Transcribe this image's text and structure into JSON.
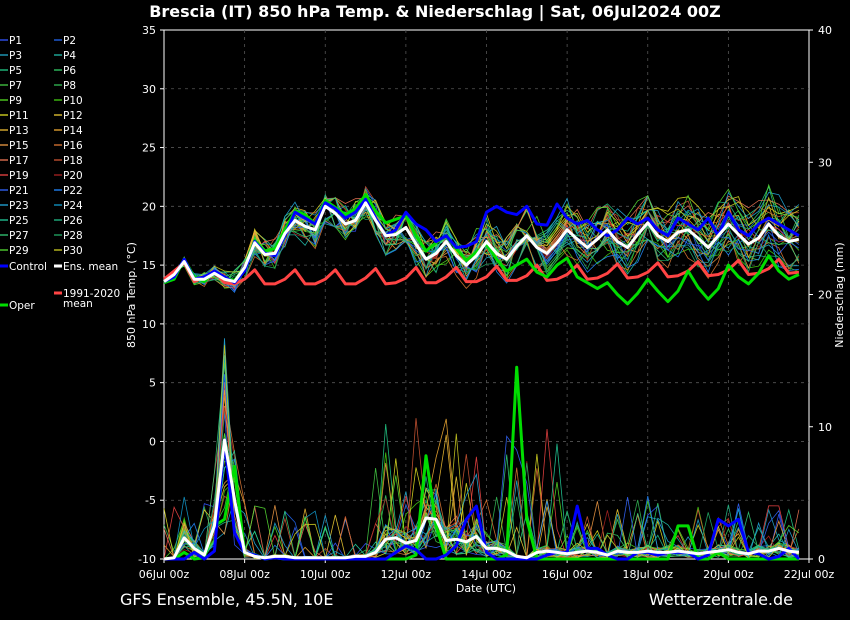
{
  "chart_data": {
    "type": "line",
    "title": "Brescia  (IT)  850 hPa Temp. & Niederschlag | Sat, 06Jul2024 00Z",
    "ylabel_left": "850 hPa Temp. (°C)",
    "ylabel_right": "Niederschlag (mm)",
    "xlabel": "Date (UTC)",
    "ylim_left": [
      -10,
      35
    ],
    "ylim_right": [
      0,
      40
    ],
    "left_ticks": [
      -10,
      -5,
      0,
      5,
      10,
      15,
      20,
      25,
      30,
      35
    ],
    "right_ticks": [
      0,
      10,
      20,
      30,
      40
    ],
    "x_ticks": [
      "06Jul 00z",
      "08Jul 00z",
      "10Jul 00z",
      "12Jul 00z",
      "14Jul 00z",
      "16Jul 00z",
      "18Jul 00z",
      "20Jul 00z",
      "22Jul 00z"
    ],
    "x_step_hours": 6,
    "grid": true,
    "legend_placement": "left outside",
    "series": [
      {
        "name": "Control",
        "color": "#0000ff",
        "temp": [
          13.6,
          14,
          15.5,
          13.8,
          14,
          14.5,
          14,
          13.5,
          14.5,
          17,
          16,
          15.8,
          17.5,
          19.5,
          19,
          18.5,
          20.3,
          19.8,
          19,
          19.5,
          20.6,
          19,
          17.5,
          18,
          19.5,
          18.5,
          18,
          17,
          17.5,
          16.5,
          16.6,
          17,
          19.5,
          20,
          19.5,
          19.3,
          20,
          18.5,
          18.4,
          20.2,
          19,
          18.5,
          18.8,
          18,
          17.5,
          18,
          19,
          18.5,
          19,
          18,
          17.5,
          19,
          18.5,
          18,
          19,
          17.5,
          19.5,
          18,
          17.5,
          18.5,
          19,
          18.5,
          18,
          17.5
        ],
        "precip": [
          0,
          0,
          0,
          0.5,
          0,
          0.6,
          9,
          2,
          0.5,
          0.3,
          0,
          0.1,
          0,
          0,
          0,
          0,
          0,
          0,
          0,
          0,
          0,
          0,
          0,
          0.5,
          1,
          0.7,
          0,
          0,
          0.3,
          1,
          3,
          4,
          0.5,
          0,
          0,
          0,
          0,
          0,
          0.3,
          0.5,
          0.5,
          4,
          0.8,
          0.8,
          0.3,
          0,
          0,
          0.5,
          0.5,
          0.3,
          0.5,
          0.5,
          0.5,
          0,
          0.3,
          3,
          2.5,
          3,
          0.5,
          0.4,
          0,
          0.2,
          0.8,
          0
        ]
      },
      {
        "name": "Ens. mean",
        "color": "#ffffff",
        "temp": [
          13.6,
          14.2,
          15.3,
          13.8,
          13.8,
          14.3,
          13.8,
          13.6,
          14.8,
          16.9,
          15.9,
          16,
          17.7,
          18.8,
          18.3,
          18,
          20,
          19.4,
          18.5,
          18.8,
          20.3,
          18.8,
          17.5,
          17.6,
          18.2,
          16.8,
          15.5,
          16,
          17,
          15.8,
          15,
          15.8,
          17,
          16,
          15.5,
          16.6,
          17.5,
          16.5,
          16,
          16.9,
          18,
          17.2,
          16.5,
          17.2,
          18,
          17,
          16.5,
          17.6,
          18.6,
          17.5,
          17,
          17.8,
          18,
          17.3,
          16.5,
          17.5,
          18.5,
          17.6,
          16.8,
          17.3,
          18.5,
          17.5,
          17,
          17.2
        ],
        "precip": [
          0,
          0.1,
          1.6,
          0.8,
          0.3,
          2.5,
          9,
          4.5,
          0.5,
          0.2,
          0.1,
          0.2,
          0.2,
          0.1,
          0.1,
          0.1,
          0.1,
          0.1,
          0.1,
          0.2,
          0.2,
          0.5,
          1.5,
          1.6,
          1.2,
          1.4,
          3.1,
          3,
          1.4,
          1.5,
          1.3,
          1.7,
          0.8,
          0.8,
          0.6,
          0.2,
          0.1,
          0.5,
          0.6,
          0.5,
          0.4,
          0.5,
          0.6,
          0.5,
          0.3,
          0.6,
          0.5,
          0.5,
          0.6,
          0.5,
          0.5,
          0.6,
          0.5,
          0.4,
          0.5,
          0.6,
          0.7,
          0.5,
          0.4,
          0.6,
          0.6,
          0.8,
          0.6,
          0.5
        ]
      },
      {
        "name": "Oper",
        "color": "#00dd00",
        "temp": [
          13.5,
          13.8,
          15.5,
          14,
          13.6,
          14.5,
          13.9,
          13.7,
          14.8,
          17.1,
          16.2,
          16.4,
          18,
          19.6,
          19.3,
          18.5,
          20.5,
          19.9,
          19.3,
          19.8,
          21,
          19.6,
          18.6,
          18.9,
          19.2,
          17.5,
          16.2,
          16.9,
          17.5,
          16.4,
          15.4,
          16.1,
          16.8,
          15.5,
          14.5,
          15,
          15.5,
          14.4,
          14,
          15,
          15.6,
          14,
          13.5,
          13,
          13.5,
          12.5,
          11.7,
          12.6,
          13.8,
          12.8,
          11.9,
          12.8,
          14.5,
          13.1,
          12.1,
          13,
          15,
          14,
          13.4,
          14.3,
          15.8,
          14.5,
          13.8,
          14.2
        ],
        "precip": [
          0,
          0,
          0.5,
          0,
          0.1,
          2.5,
          3,
          7,
          0.5,
          0.3,
          0,
          0.1,
          0,
          0,
          0,
          0,
          0,
          0,
          0,
          0,
          0,
          0,
          0,
          0,
          0,
          0.3,
          7.8,
          2.5,
          0,
          0,
          0,
          0,
          0,
          0,
          0.3,
          14.5,
          3,
          0,
          0,
          0,
          0,
          0,
          0,
          0,
          0,
          0,
          0,
          0,
          0,
          0,
          0,
          2.5,
          2.5,
          0,
          0,
          0.5,
          0,
          0,
          0,
          0,
          0,
          0,
          0,
          0
        ]
      },
      {
        "name": "1991-2020 mean",
        "color": "#ff4444",
        "temp": [
          13.8,
          14.5,
          15.2,
          13.6,
          14,
          14.5,
          13.5,
          13.4,
          13.8,
          14.6,
          13.4,
          13.4,
          13.8,
          14.6,
          13.4,
          13.4,
          13.8,
          14.6,
          13.4,
          13.4,
          13.9,
          14.7,
          13.4,
          13.5,
          13.9,
          14.8,
          13.5,
          13.5,
          14,
          14.8,
          13.6,
          13.6,
          14,
          14.9,
          13.7,
          13.7,
          14.1,
          15,
          13.7,
          13.8,
          14.2,
          15,
          13.8,
          13.9,
          14.3,
          15.1,
          13.9,
          14,
          14.4,
          15.2,
          14,
          14.1,
          14.5,
          15.3,
          14.1,
          14.2,
          14.6,
          15.4,
          14.2,
          14.3,
          14.7,
          15.5,
          14.3,
          14.4
        ]
      }
    ],
    "ensemble_members": [
      "P1",
      "P2",
      "P3",
      "P4",
      "P5",
      "P6",
      "P7",
      "P8",
      "P9",
      "P10",
      "P11",
      "P12",
      "P13",
      "P14",
      "P15",
      "P16",
      "P17",
      "P18",
      "P19",
      "P20",
      "P21",
      "P22",
      "P23",
      "P24",
      "P25",
      "P26",
      "P27",
      "P28",
      "P29",
      "P30"
    ],
    "member_colors": [
      "#3355ff",
      "#2266ee",
      "#22aacc",
      "#22bbaa",
      "#22cc88",
      "#33cc66",
      "#44cc44",
      "#33bb55",
      "#55dd22",
      "#44cc11",
      "#dddd22",
      "#eecc33",
      "#eebb33",
      "#eeaa33",
      "#ee9944",
      "#dd7733",
      "#ee7755",
      "#cc5533",
      "#ee4444",
      "#aa2222",
      "#3366ff",
      "#2288ff",
      "#22aadd",
      "#1199cc",
      "#22cc99",
      "#22bb88",
      "#33cc77",
      "#22aa66",
      "#55dd33",
      "#cccc22"
    ]
  },
  "legend": {
    "members": [
      [
        "P1",
        "P2"
      ],
      [
        "P3",
        "P4"
      ],
      [
        "P5",
        "P6"
      ],
      [
        "P7",
        "P8"
      ],
      [
        "P9",
        "P10"
      ],
      [
        "P11",
        "P12"
      ],
      [
        "P13",
        "P14"
      ],
      [
        "P15",
        "P16"
      ],
      [
        "P17",
        "P18"
      ],
      [
        "P19",
        "P20"
      ],
      [
        "P21",
        "P22"
      ],
      [
        "P23",
        "P24"
      ],
      [
        "P25",
        "P26"
      ],
      [
        "P27",
        "P28"
      ],
      [
        "P29",
        "P30"
      ]
    ],
    "control": "Control",
    "ens_mean": "Ens. mean",
    "oper": "Oper",
    "clim_line1": "1991-2020",
    "clim_line2": "mean"
  },
  "footer": {
    "left": "GFS Ensemble, 45.5N, 10E",
    "right": "Wetterzentrale.de"
  }
}
